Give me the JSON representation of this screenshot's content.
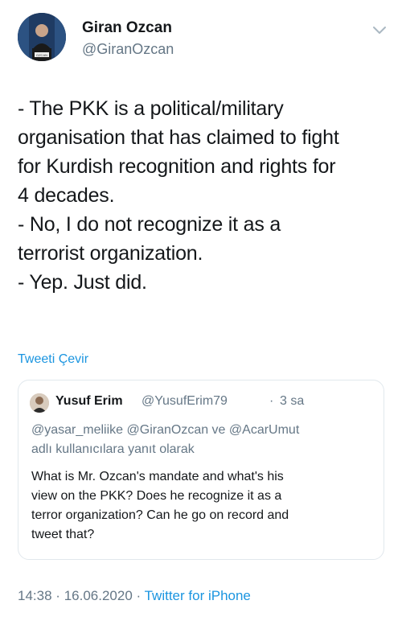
{
  "author": {
    "name": "Giran Ozcan",
    "handle": "@GiranOzcan",
    "avatar_caption": "OZCAN"
  },
  "tweet": {
    "lines": [
      "- The PKK is a political/military",
      "organisation that has claimed to fight",
      "for Kurdish recognition and rights for",
      "4 decades.",
      "- No, I do not recognize it as a",
      "terrorist organization.",
      "- Yep. Just did."
    ],
    "translate_label": "Tweeti Çevir"
  },
  "quoted": {
    "name": "Yusuf Erim",
    "handle": "@YusufErim79",
    "separator": "·",
    "time": "3 sa",
    "reply_line1": "@yasar_meliike @GiranOzcan ve @AcarUmut",
    "reply_line2": "adlı kullanıcılara yanıt olarak",
    "lines": [
      "What is Mr. Ozcan's mandate and what's his",
      "view on the PKK? Does he recognize it as a",
      "terror organization? Can he go on record and",
      "tweet that?"
    ]
  },
  "meta": {
    "time": "14:38",
    "dot1": "·",
    "date": "16.06.2020",
    "dot2": "·",
    "source": "Twitter for iPhone"
  },
  "colors": {
    "link": "#1b95e0",
    "secondary": "#657786",
    "text": "#14171a",
    "border": "#e1e8ed"
  },
  "icons": {
    "menu": "chevron-down-icon"
  }
}
